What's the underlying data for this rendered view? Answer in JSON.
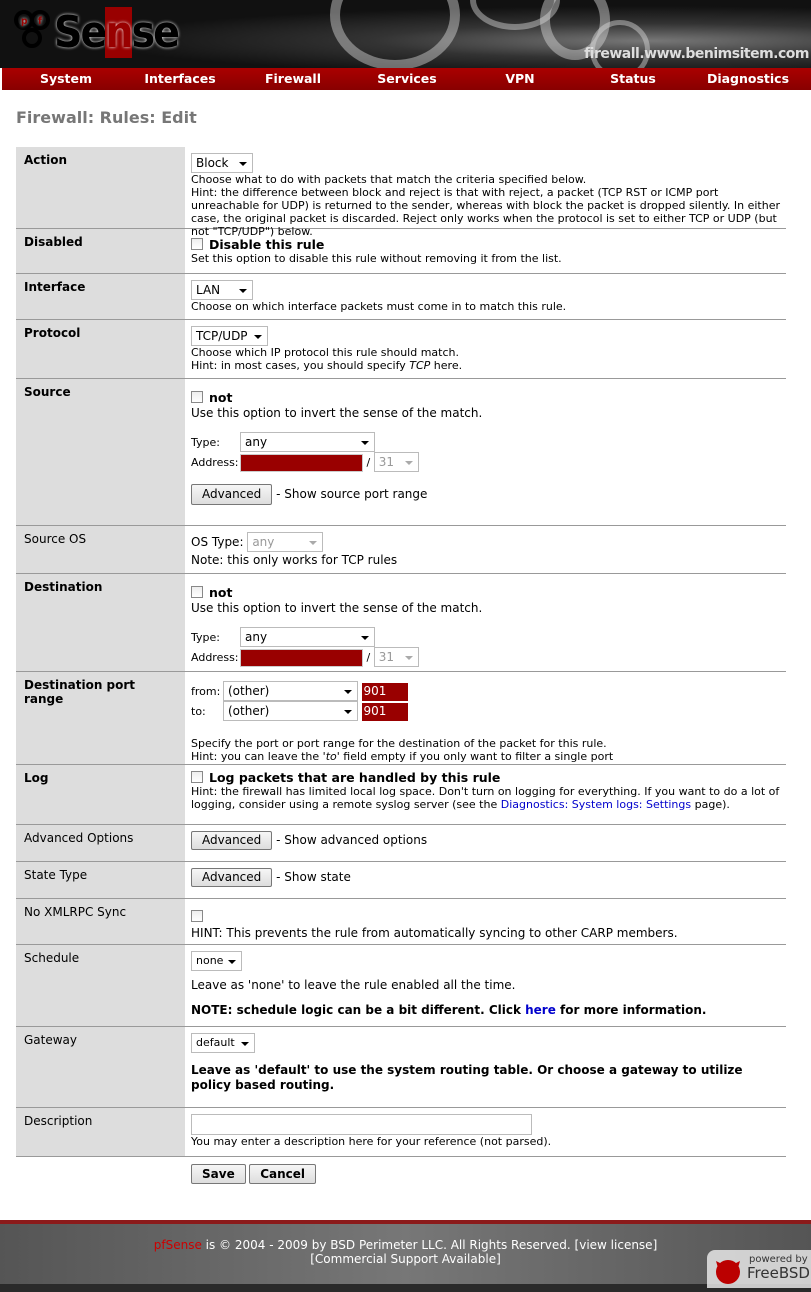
{
  "header": {
    "logo": "pfSense",
    "hostname": "firewall.www.benimsitem.com"
  },
  "nav": [
    "System",
    "Interfaces",
    "Firewall",
    "Services",
    "VPN",
    "Status",
    "Diagnostics"
  ],
  "page_title": "Firewall: Rules: Edit",
  "action": {
    "label": "Action",
    "value": "Block",
    "help": [
      "Choose what to do with packets that match the criteria specified below.",
      "Hint: the difference between block and reject is that with reject, a packet (TCP RST or ICMP port unreachable for UDP) is returned to the sender, whereas with block the packet is dropped silently. In either case, the original packet is discarded. Reject only works when the protocol is set to either TCP or UDP (but not \"TCP/UDP\") below."
    ]
  },
  "disabled": {
    "label": "Disabled",
    "checkbox": "Disable this rule",
    "help": "Set this option to disable this rule without removing it from the list."
  },
  "interface": {
    "label": "Interface",
    "value": "LAN",
    "help": "Choose on which interface packets must come in to match this rule."
  },
  "protocol": {
    "label": "Protocol",
    "value": "TCP/UDP",
    "help1": "Choose which IP protocol this rule should match.",
    "help2_pre": "Hint: in most cases, you should specify ",
    "help2_em": "TCP",
    "help2_post": " here."
  },
  "source": {
    "label": "Source",
    "not": "not",
    "not_help": "Use this option to invert the sense of the match.",
    "type_label": "Type:",
    "type": "any",
    "address_label": "Address:",
    "mask": "31",
    "advanced": "Advanced",
    "advanced_help": "- Show source port range"
  },
  "source_os": {
    "label": "Source OS",
    "os_label": "OS Type:",
    "os": "any",
    "note": "Note: this only works for TCP rules"
  },
  "destination": {
    "label": "Destination",
    "not": "not",
    "not_help": "Use this option to invert the sense of the match.",
    "type_label": "Type:",
    "type": "any",
    "address_label": "Address:",
    "mask": "31"
  },
  "dest_port": {
    "label": "Destination port range",
    "from_label": "from:",
    "from": "(other)",
    "from_port": "901",
    "to_label": "to:",
    "to": "(other)",
    "to_port": "901",
    "help1": "Specify the port or port range for the destination of the packet for this rule.",
    "help2_pre": "Hint: you can leave the ",
    "help2_em": "'to'",
    "help2_post": " field empty if you only want to filter a single port"
  },
  "log": {
    "label": "Log",
    "checkbox": "Log packets that are handled by this rule",
    "help_pre": "Hint: the firewall has limited local log space. Don't turn on logging for everything. If you want to do a lot of logging, consider using a remote syslog server (see the ",
    "help_link": "Diagnostics: System logs: Settings",
    "help_post": " page)."
  },
  "advanced_options": {
    "label": "Advanced Options",
    "button": "Advanced",
    "help": "- Show advanced options"
  },
  "state_type": {
    "label": "State Type",
    "button": "Advanced",
    "help": "- Show state"
  },
  "xmlrpc": {
    "label": "No XMLRPC Sync",
    "help": "HINT: This prevents the rule from automatically syncing to other CARP members."
  },
  "schedule": {
    "label": "Schedule",
    "value": "none",
    "help": "Leave as 'none' to leave the rule enabled all the time.",
    "note_pre": "NOTE: schedule logic can be a bit different. Click ",
    "note_link": "here",
    "note_post": " for more information."
  },
  "gateway": {
    "label": "Gateway",
    "value": "default",
    "help": "Leave as 'default' to use the system routing table. Or choose a gateway to utilize policy based routing."
  },
  "description": {
    "label": "Description",
    "value": "",
    "help": "You may enter a description here for your reference (not parsed)."
  },
  "buttons": {
    "save": "Save",
    "cancel": "Cancel"
  },
  "footer": {
    "brand": "pfSense",
    "copyright": " is © 2004 - 2009 by BSD Perimeter LLC. All Rights Reserved. ",
    "license": "[view license]",
    "support": "[Commercial Support Available]",
    "powered_by": "powered by",
    "freebsd": "FreeBSD"
  },
  "colors": {
    "brand_red": "#990000",
    "invalid_field": "#990000",
    "label_bg": "#dddddd",
    "link": "#0000cc"
  }
}
